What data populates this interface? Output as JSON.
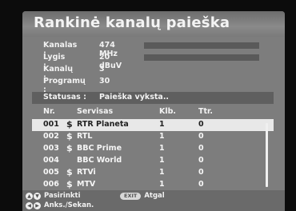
{
  "title": "Rankinė kanalų paieška",
  "info": [
    {
      "label": "Kanalas :",
      "value": "474 MHz",
      "bar": true
    },
    {
      "label": "Lygis :",
      "value": "20 dBuV",
      "bar": true
    },
    {
      "label": "Kanalų :",
      "value": "3",
      "bar": false
    },
    {
      "label": "Programų :",
      "value": "30",
      "bar": false
    }
  ],
  "status": {
    "label": "Statusas :",
    "value": "Paieška vykstа.."
  },
  "table": {
    "headers": {
      "nr": "Nr.",
      "service": "Servisas",
      "kib": "Klb.",
      "ttr": "Ttr."
    },
    "rows": [
      {
        "nr": "001",
        "scrambled": "$",
        "service": "RTR Planeta",
        "kib": "1",
        "ttr": "0",
        "selected": true
      },
      {
        "nr": "002",
        "scrambled": "$",
        "service": "RTL",
        "kib": "1",
        "ttr": "0",
        "selected": false
      },
      {
        "nr": "003",
        "scrambled": "$",
        "service": "BBC Prime",
        "kib": "1",
        "ttr": "0",
        "selected": false
      },
      {
        "nr": "004",
        "scrambled": "",
        "service": "BBC World",
        "kib": "1",
        "ttr": "0",
        "selected": false
      },
      {
        "nr": "005",
        "scrambled": "$",
        "service": "RTVi",
        "kib": "1",
        "ttr": "0",
        "selected": false
      },
      {
        "nr": "006",
        "scrambled": "$",
        "service": "MTV",
        "kib": "1",
        "ttr": "0",
        "selected": false
      }
    ]
  },
  "footer": {
    "select_label": "Pasirinkti",
    "exit_key": "EXIT",
    "back_label": "Atgal",
    "page_label": "Anks./Sekan.",
    "icons": {
      "up": "▲",
      "down": "▼",
      "left": "◀",
      "right": "▶"
    }
  }
}
